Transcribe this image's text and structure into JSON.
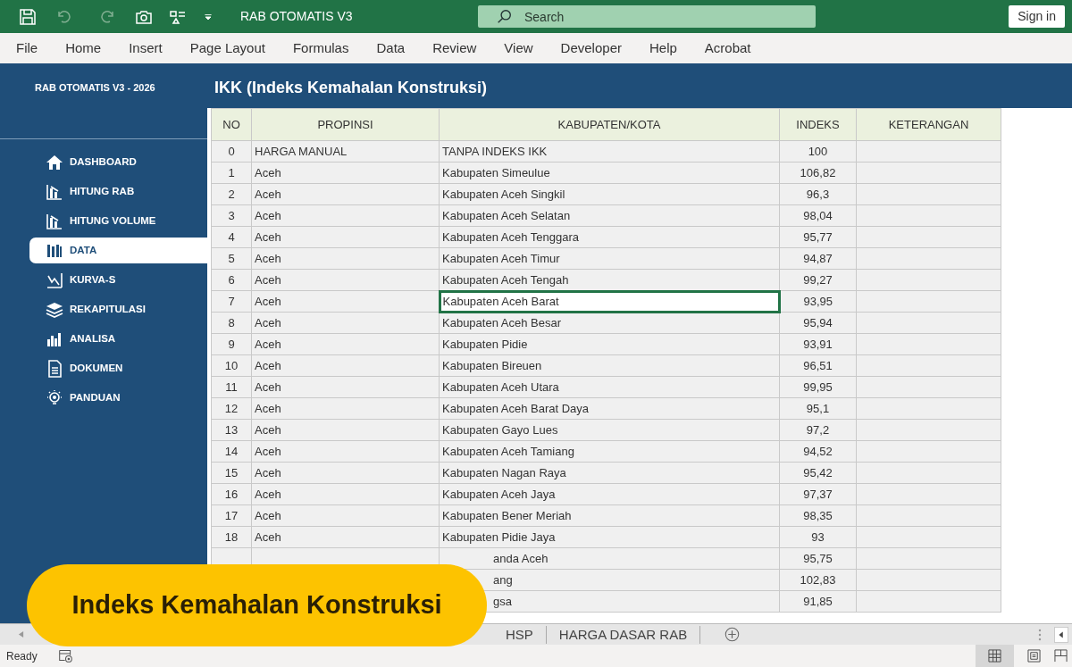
{
  "window": {
    "title": "RAB OTOMATIS V3"
  },
  "search": {
    "placeholder": "Search"
  },
  "sign_in": "Sign in",
  "ribbon_tabs": [
    "File",
    "Home",
    "Insert",
    "Page Layout",
    "Formulas",
    "Data",
    "Review",
    "View",
    "Developer",
    "Help",
    "Acrobat"
  ],
  "sidebar": {
    "title": "RAB OTOMATIS V3 - 2026",
    "items": [
      {
        "label": "DASHBOARD",
        "selected": false
      },
      {
        "label": "HITUNG RAB",
        "selected": false
      },
      {
        "label": "HITUNG VOLUME",
        "selected": false
      },
      {
        "label": "DATA",
        "selected": true
      },
      {
        "label": "KURVA-S",
        "selected": false
      },
      {
        "label": "REKAPITULASI",
        "selected": false
      },
      {
        "label": "ANALISA",
        "selected": false
      },
      {
        "label": "DOKUMEN",
        "selected": false
      },
      {
        "label": "PANDUAN",
        "selected": false
      }
    ]
  },
  "sheet_title": "IKK (Indeks Kemahalan Konstruksi)",
  "table": {
    "columns": [
      "NO",
      "PROPINSI",
      "KABUPATEN/KOTA",
      "INDEKS",
      "KETERANGAN"
    ],
    "rows": [
      {
        "no": "0",
        "propinsi": "HARGA MANUAL",
        "kabupaten": "TANPA INDEKS IKK",
        "indeks": "100",
        "selected": false
      },
      {
        "no": "1",
        "propinsi": "Aceh",
        "kabupaten": "Kabupaten Simeulue",
        "indeks": "106,82",
        "selected": false
      },
      {
        "no": "2",
        "propinsi": "Aceh",
        "kabupaten": "Kabupaten Aceh Singkil",
        "indeks": "96,3",
        "selected": false
      },
      {
        "no": "3",
        "propinsi": "Aceh",
        "kabupaten": "Kabupaten Aceh Selatan",
        "indeks": "98,04",
        "selected": false
      },
      {
        "no": "4",
        "propinsi": "Aceh",
        "kabupaten": "Kabupaten Aceh Tenggara",
        "indeks": "95,77",
        "selected": false
      },
      {
        "no": "5",
        "propinsi": "Aceh",
        "kabupaten": "Kabupaten Aceh Timur",
        "indeks": "94,87",
        "selected": false
      },
      {
        "no": "6",
        "propinsi": "Aceh",
        "kabupaten": "Kabupaten Aceh Tengah",
        "indeks": "99,27",
        "selected": false
      },
      {
        "no": "7",
        "propinsi": "Aceh",
        "kabupaten": "Kabupaten Aceh Barat",
        "indeks": "93,95",
        "selected": true
      },
      {
        "no": "8",
        "propinsi": "Aceh",
        "kabupaten": "Kabupaten Aceh Besar",
        "indeks": "95,94",
        "selected": false
      },
      {
        "no": "9",
        "propinsi": "Aceh",
        "kabupaten": "Kabupaten Pidie",
        "indeks": "93,91",
        "selected": false
      },
      {
        "no": "10",
        "propinsi": "Aceh",
        "kabupaten": "Kabupaten Bireuen",
        "indeks": "96,51",
        "selected": false
      },
      {
        "no": "11",
        "propinsi": "Aceh",
        "kabupaten": "Kabupaten Aceh Utara",
        "indeks": "99,95",
        "selected": false
      },
      {
        "no": "12",
        "propinsi": "Aceh",
        "kabupaten": "Kabupaten Aceh Barat Daya",
        "indeks": "95,1",
        "selected": false
      },
      {
        "no": "13",
        "propinsi": "Aceh",
        "kabupaten": "Kabupaten Gayo Lues",
        "indeks": "97,2",
        "selected": false
      },
      {
        "no": "14",
        "propinsi": "Aceh",
        "kabupaten": "Kabupaten Aceh Tamiang",
        "indeks": "94,52",
        "selected": false
      },
      {
        "no": "15",
        "propinsi": "Aceh",
        "kabupaten": "Kabupaten Nagan Raya",
        "indeks": "95,42",
        "selected": false
      },
      {
        "no": "16",
        "propinsi": "Aceh",
        "kabupaten": "Kabupaten Aceh Jaya",
        "indeks": "97,37",
        "selected": false
      },
      {
        "no": "17",
        "propinsi": "Aceh",
        "kabupaten": "Kabupaten Bener Meriah",
        "indeks": "98,35",
        "selected": false
      },
      {
        "no": "18",
        "propinsi": "Aceh",
        "kabupaten": "Kabupaten Pidie Jaya",
        "indeks": "93",
        "selected": false
      },
      {
        "kabupaten": "anda Aceh",
        "indeks": "95,75",
        "selected": false
      },
      {
        "kabupaten": "ang",
        "indeks": "102,83",
        "selected": false
      },
      {
        "kabupaten": "gsa",
        "indeks": "91,85",
        "selected": false
      }
    ]
  },
  "sheet_tabs": [
    "HSP",
    "HARGA DASAR RAB"
  ],
  "status_bar": {
    "text": "Ready"
  },
  "banner": "Indeks Kemahalan Konstruksi"
}
